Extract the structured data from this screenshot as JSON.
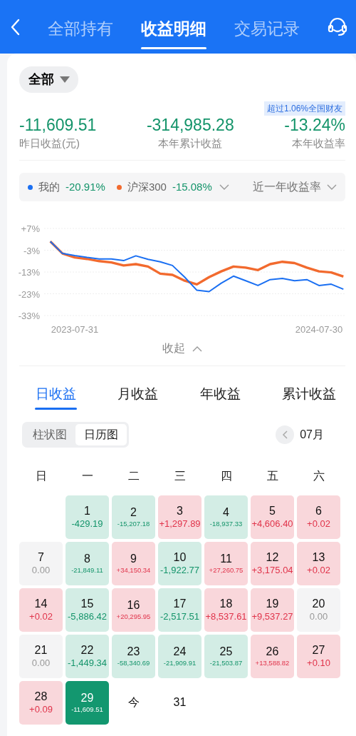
{
  "header": {
    "tabs": [
      {
        "label": "全部持有",
        "selected": false
      },
      {
        "label": "收益明细",
        "selected": true
      },
      {
        "label": "交易记录",
        "selected": false
      }
    ]
  },
  "summary": {
    "filter": "全部",
    "rank_badge": "超过1.06%全国财友",
    "stats": [
      {
        "value": "-11,609.51",
        "label": "昨日收益(元)"
      },
      {
        "value": "-314,985.28",
        "label": "本年累计收益"
      },
      {
        "value": "-13.24%",
        "label": "本年收益率"
      }
    ]
  },
  "legend": {
    "items": [
      {
        "value": "-20.91%",
        "color": "#1a6ff2"
      },
      {
        "value": "-15.08%",
        "color": "#f26a2e"
      }
    ],
    "period": "近一年收益率"
  },
  "chart_data": {
    "type": "line",
    "grid": true,
    "categories": [
      null,
      null,
      "2023-07-31",
      null,
      null,
      null,
      null,
      null,
      null,
      null,
      null,
      null,
      null,
      null,
      null,
      null,
      null,
      null,
      null,
      null,
      null,
      null,
      "2024-07-30",
      null,
      null
    ],
    "series": [
      {
        "name": "我的",
        "color": "#1a6ff2",
        "values": [
          1.0,
          -4.5,
          -5.5,
          -6.3,
          -7.0,
          -7.0,
          -7.8,
          -5.6,
          -7.2,
          -8.3,
          -10,
          -15.4,
          -21.4,
          -22,
          -18.1,
          -14.9,
          -17,
          -19.2,
          -16.5,
          -16,
          -17,
          -16.5,
          -19.2,
          -18.6,
          -20.9
        ]
      },
      {
        "name": "沪深300",
        "color": "#f26a2e",
        "values": [
          1.0,
          -4.5,
          -6.3,
          -7.0,
          -8.0,
          -8.6,
          -10,
          -9.4,
          -10.5,
          -13.8,
          -14.3,
          -17,
          -18.7,
          -15.4,
          -12.7,
          -10.5,
          -11,
          -12.1,
          -9.4,
          -8.3,
          -8.9,
          -11,
          -12.7,
          -13.2,
          -15.1
        ]
      }
    ],
    "ylim": [
      -33,
      7
    ],
    "yticks": [
      {
        "value": 7,
        "label": "+7%"
      },
      {
        "value": -3,
        "label": "-3%"
      },
      {
        "value": -13,
        "label": "-13%"
      },
      {
        "value": -23,
        "label": "-23%"
      },
      {
        "value": -33,
        "label": "-33%"
      }
    ]
  },
  "collapse": "收起",
  "period_tabs": [
    {
      "label": "日收益",
      "selected": true
    },
    {
      "label": "月收益",
      "selected": false
    },
    {
      "label": "年收益",
      "selected": false
    },
    {
      "label": "累计收益",
      "selected": false
    }
  ],
  "view_toggle": [
    {
      "label": "柱状图",
      "selected": false
    },
    {
      "label": "日历图",
      "selected": true
    }
  ],
  "month": "07月",
  "weekdays": [
    "日",
    "一",
    "二",
    "三",
    "四",
    "五",
    "六"
  ],
  "days": [
    {
      "kind": "blank"
    },
    {
      "day": "1",
      "value": "-429.19",
      "kind": "loss",
      "selected": false
    },
    {
      "day": "2",
      "value": "-15,207.18",
      "kind": "loss",
      "selected": false
    },
    {
      "day": "3",
      "value": "+1,297.89",
      "kind": "gain",
      "selected": false
    },
    {
      "day": "4",
      "value": "-18,937.33",
      "kind": "loss",
      "selected": false
    },
    {
      "day": "5",
      "value": "+4,606.40",
      "kind": "gain",
      "selected": false
    },
    {
      "day": "6",
      "value": "+0.02",
      "kind": "gain",
      "selected": false
    },
    {
      "day": "7",
      "value": "0.00",
      "kind": "flat",
      "selected": false
    },
    {
      "day": "8",
      "value": "-21,849.11",
      "kind": "loss",
      "selected": false
    },
    {
      "day": "9",
      "value": "+34,150.34",
      "kind": "gain",
      "selected": false
    },
    {
      "day": "10",
      "value": "-1,922.77",
      "kind": "loss",
      "selected": false
    },
    {
      "day": "11",
      "value": "+27,260.75",
      "kind": "gain",
      "selected": false
    },
    {
      "day": "12",
      "value": "+3,175.04",
      "kind": "gain",
      "selected": false
    },
    {
      "day": "13",
      "value": "+0.02",
      "kind": "gain",
      "selected": false
    },
    {
      "day": "14",
      "value": "+0.02",
      "kind": "gain",
      "selected": false
    },
    {
      "day": "15",
      "value": "-5,886.42",
      "kind": "loss",
      "selected": false
    },
    {
      "day": "16",
      "value": "+20,295.95",
      "kind": "gain",
      "selected": false
    },
    {
      "day": "17",
      "value": "-2,517.51",
      "kind": "loss",
      "selected": false
    },
    {
      "day": "18",
      "value": "+8,537.61",
      "kind": "gain",
      "selected": false
    },
    {
      "day": "19",
      "value": "+9,537.27",
      "kind": "gain",
      "selected": false
    },
    {
      "day": "20",
      "value": "0.00",
      "kind": "flat",
      "selected": false
    },
    {
      "day": "21",
      "value": "0.00",
      "kind": "flat",
      "selected": false
    },
    {
      "day": "22",
      "value": "-1,449.34",
      "kind": "loss",
      "selected": false
    },
    {
      "day": "23",
      "value": "-58,340.69",
      "kind": "loss",
      "selected": false
    },
    {
      "day": "24",
      "value": "-21,909.91",
      "kind": "loss",
      "selected": false
    },
    {
      "day": "25",
      "value": "-21,503.87",
      "kind": "loss",
      "selected": false
    },
    {
      "day": "26",
      "value": "+13,588.82",
      "kind": "gain",
      "selected": false
    },
    {
      "day": "27",
      "value": "+0.10",
      "kind": "gain",
      "selected": false
    },
    {
      "day": "28",
      "value": "+0.09",
      "kind": "gain",
      "selected": false
    },
    {
      "day": "29",
      "value": "-11,609.51",
      "kind": "loss",
      "selected": true
    },
    {
      "day": "今",
      "kind": "today",
      "selected": false
    },
    {
      "day": "31",
      "kind": "future",
      "selected": false
    }
  ]
}
